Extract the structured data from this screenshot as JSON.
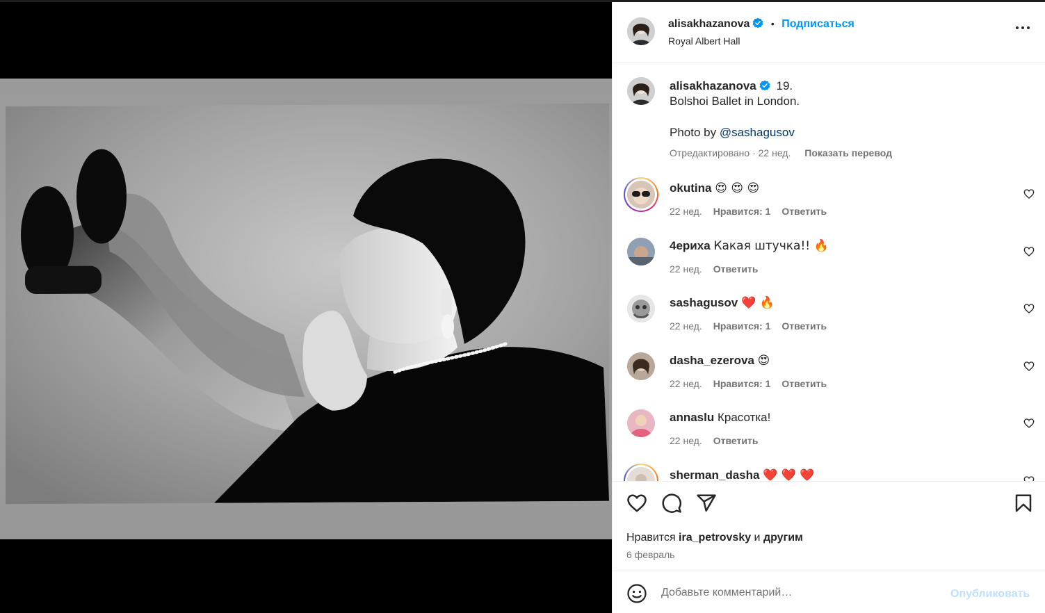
{
  "post_header": {
    "username": "alisakhazanova",
    "separator": "•",
    "follow_label": "Подписаться",
    "location": "Royal Albert Hall",
    "more_icon": "more-horizontal-icon"
  },
  "caption": {
    "username": "alisakhazanova",
    "line1": "19.",
    "line2": "Bolshoi Ballet in London.",
    "line3_prefix": "Photo by ",
    "line3_mention": "@sashagusov",
    "edited": "Отредактировано · 22 нед.",
    "translate": "Показать перевод"
  },
  "comments": [
    {
      "username": "okutina",
      "text": "😍 😍 😍",
      "age": "22 нед.",
      "likes": "Нравится: 1",
      "reply": "Ответить",
      "story_ring": true
    },
    {
      "username": "4ериха",
      "text": "Какая штучка!! 🔥",
      "age": "22 нед.",
      "likes": "",
      "reply": "Ответить",
      "story_ring": false
    },
    {
      "username": "sashagusov",
      "text": "❤️ 🔥",
      "age": "22 нед.",
      "likes": "Нравится: 1",
      "reply": "Ответить",
      "story_ring": false
    },
    {
      "username": "dasha_ezerova",
      "text": "😍",
      "age": "22 нед.",
      "likes": "Нравится: 1",
      "reply": "Ответить",
      "story_ring": false
    },
    {
      "username": "annaslu",
      "text": "Красотка!",
      "age": "22 нед.",
      "likes": "",
      "reply": "Ответить",
      "story_ring": false
    },
    {
      "username": "sherman_dasha",
      "text": "❤️ ❤️ ❤️",
      "age": "",
      "likes": "",
      "reply": "",
      "story_ring": true
    }
  ],
  "actions": {
    "icons": [
      "heart-icon",
      "comment-icon",
      "share-icon",
      "bookmark-icon"
    ],
    "likes_prefix": "Нравится ",
    "likes_user": "ira_petrovsky",
    "likes_middle": " и ",
    "likes_suffix": "другим",
    "date": "6 февраль"
  },
  "composer": {
    "placeholder": "Добавьте комментарий…",
    "publish_label": "Опубликовать",
    "emoji_icon": "smile-icon"
  },
  "colors": {
    "accent": "#0095f6",
    "publish_disabled": "#c0dffd",
    "muted": "#737373",
    "heart_red": "#ed4956"
  }
}
